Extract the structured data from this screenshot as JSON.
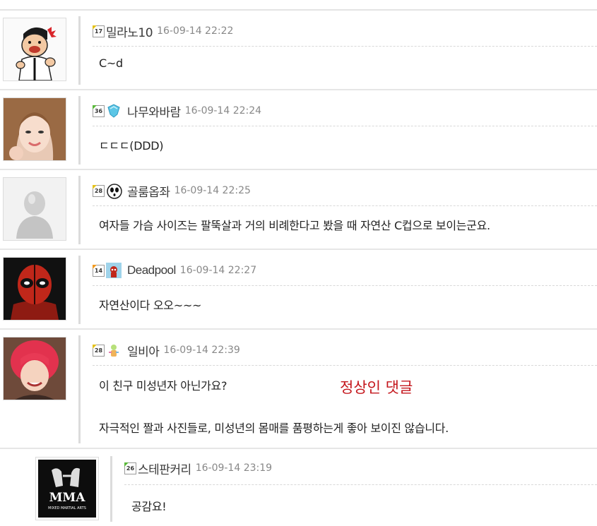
{
  "comments": [
    {
      "level": "17",
      "nickname": "밀라노10",
      "datetime": "16-09-14 22:22",
      "lines": [
        "C~d"
      ]
    },
    {
      "level": "36",
      "nickname": "나무와바람",
      "datetime": "16-09-14 22:24",
      "lines": [
        "ㄷㄷㄷ(DDD)"
      ]
    },
    {
      "level": "28",
      "nickname": "골룸옵좌",
      "datetime": "16-09-14 22:25",
      "lines": [
        "여자들 가슴 사이즈는 팔뚝살과 거의 비례한다고 봤을 때 자연산 C컵으로 보이는군요."
      ]
    },
    {
      "level": "14",
      "nickname": "Deadpool",
      "datetime": "16-09-14 22:27",
      "lines": [
        "자연산이다 오오~~~"
      ]
    },
    {
      "level": "28",
      "nickname": "일비아",
      "datetime": "16-09-14 22:39",
      "lines": [
        "이 친구 미성년자 아닌가요?",
        "자극적인 짤과 사진들로, 미성년의 몸매를 품평하는게 좋아 보이진 않습니다."
      ],
      "note": "정상인 댓글"
    },
    {
      "level": "26",
      "nickname": "스테판커리",
      "datetime": "16-09-14 23:19",
      "lines": [
        "공감요!"
      ],
      "avatar_text": "MMA",
      "avatar_subtext": "MIXED MARTIAL ARTS"
    }
  ]
}
